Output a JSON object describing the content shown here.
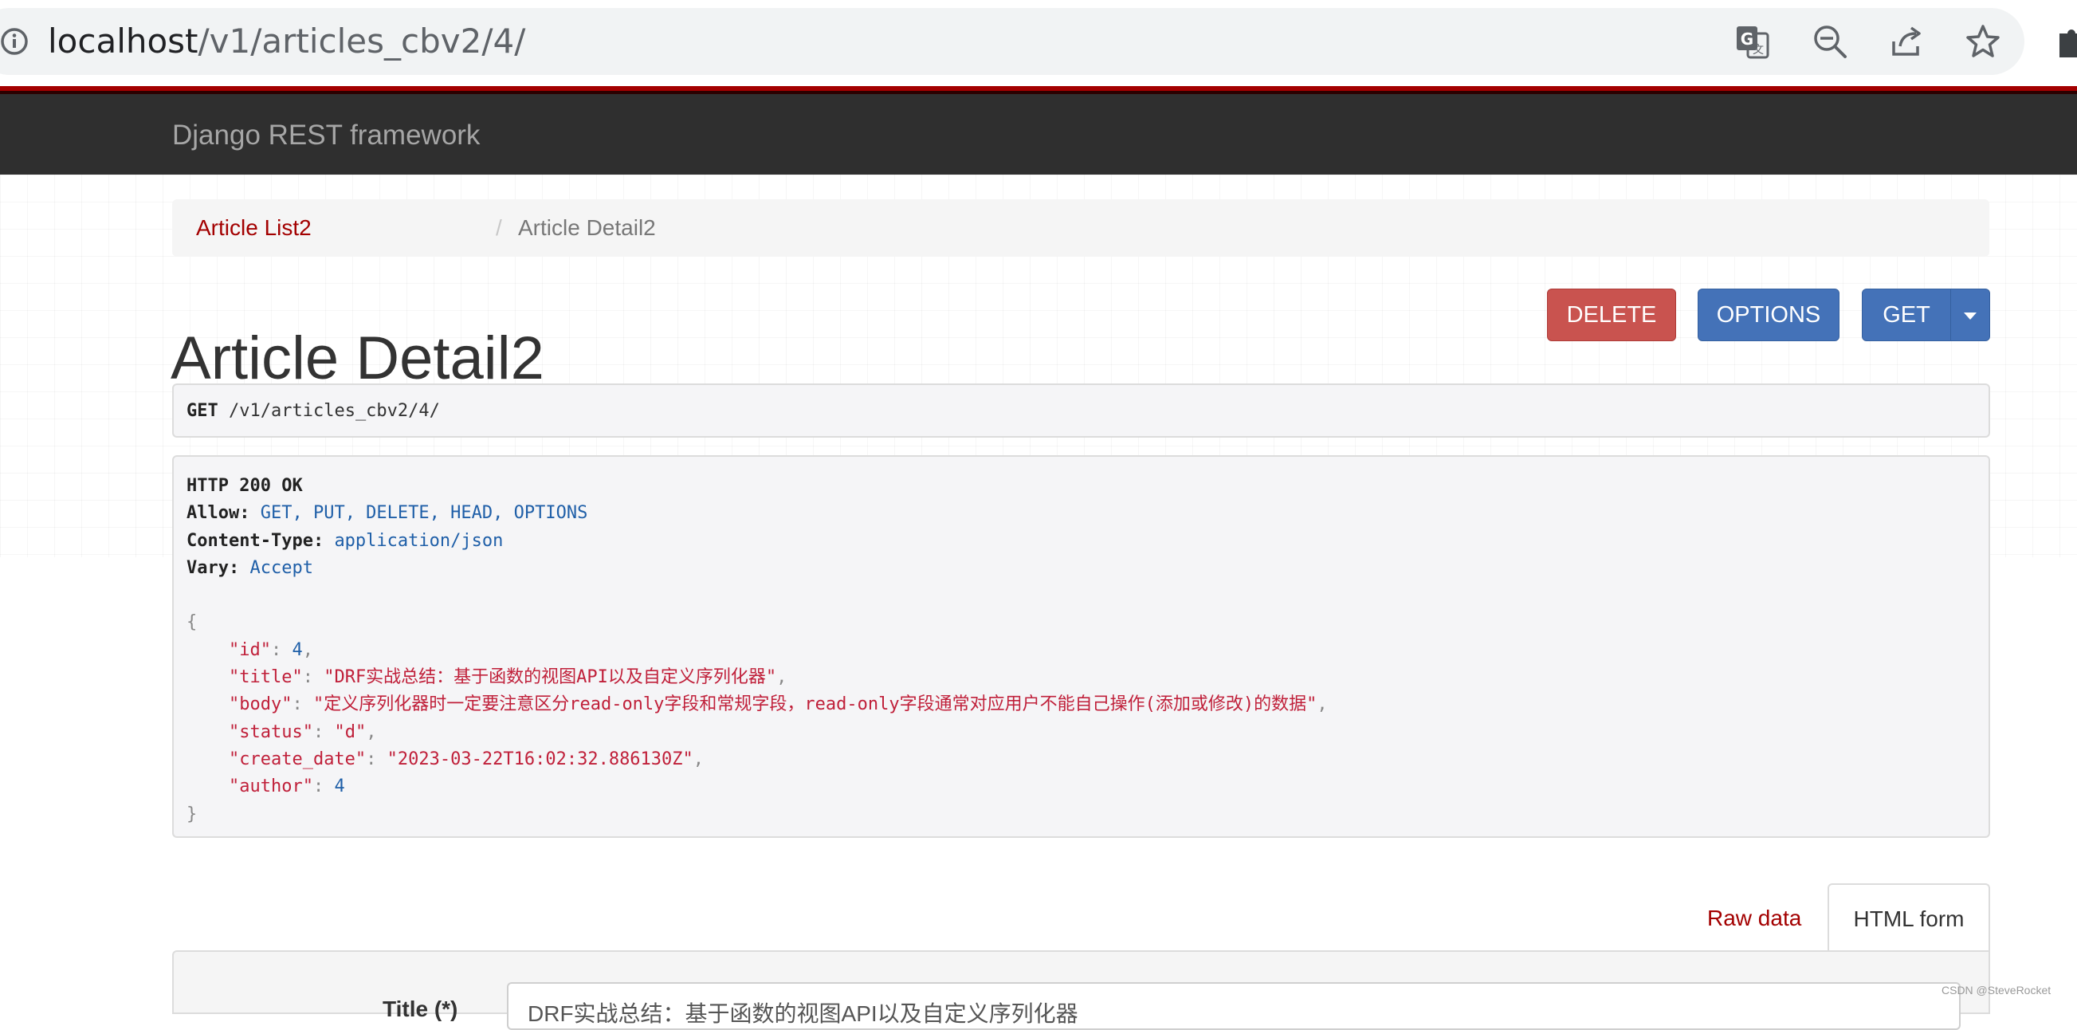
{
  "browser": {
    "url_host": "localhost",
    "url_path": "/v1/articles_cbv2/4/",
    "icons": [
      "info-icon",
      "translate-icon",
      "zoom-out-icon",
      "share-icon",
      "bookmark-star-icon",
      "extensions-icon"
    ]
  },
  "navbar": {
    "brand": "Django REST framework"
  },
  "breadcrumb": {
    "link": "Article List2",
    "separator": "/",
    "active": "Article Detail2"
  },
  "page": {
    "title": "Article Detail2"
  },
  "buttons": {
    "delete": "DELETE",
    "options": "OPTIONS",
    "get": "GET"
  },
  "request": {
    "method": "GET",
    "path": "/v1/articles_cbv2/4/"
  },
  "response": {
    "status_line": "HTTP 200 OK",
    "headers": [
      {
        "name": "Allow:",
        "value": "GET, PUT, DELETE, HEAD, OPTIONS"
      },
      {
        "name": "Content-Type:",
        "value": "application/json"
      },
      {
        "name": "Vary:",
        "value": "Accept"
      }
    ],
    "open_brace": "{",
    "close_brace": "}",
    "body": [
      {
        "key": "\"id\"",
        "value": "4",
        "type": "num"
      },
      {
        "key": "\"title\"",
        "value": "\"DRF实战总结：基于函数的视图API以及自定义序列化器\"",
        "type": "str"
      },
      {
        "key": "\"body\"",
        "value": "\"定义序列化器时一定要注意区分read-only字段和常规字段，read-only字段通常对应用户不能自己操作(添加或修改)的数据\"",
        "type": "str"
      },
      {
        "key": "\"status\"",
        "value": "\"d\"",
        "type": "str"
      },
      {
        "key": "\"create_date\"",
        "value": "\"2023-03-22T16:02:32.886130Z\"",
        "type": "str"
      },
      {
        "key": "\"author\"",
        "value": "4",
        "type": "num"
      }
    ]
  },
  "tabs": {
    "raw": "Raw data",
    "html": "HTML form"
  },
  "form": {
    "title_label": "Title (*)",
    "title_value": "DRF实战总结：基于函数的视图API以及自定义序列化器"
  },
  "watermark": "CSDN @SteveRocket",
  "colors": {
    "brand_red": "#a30000",
    "danger": "#c9534f",
    "primary": "#4472b8",
    "navbar": "#2f2f2f"
  }
}
